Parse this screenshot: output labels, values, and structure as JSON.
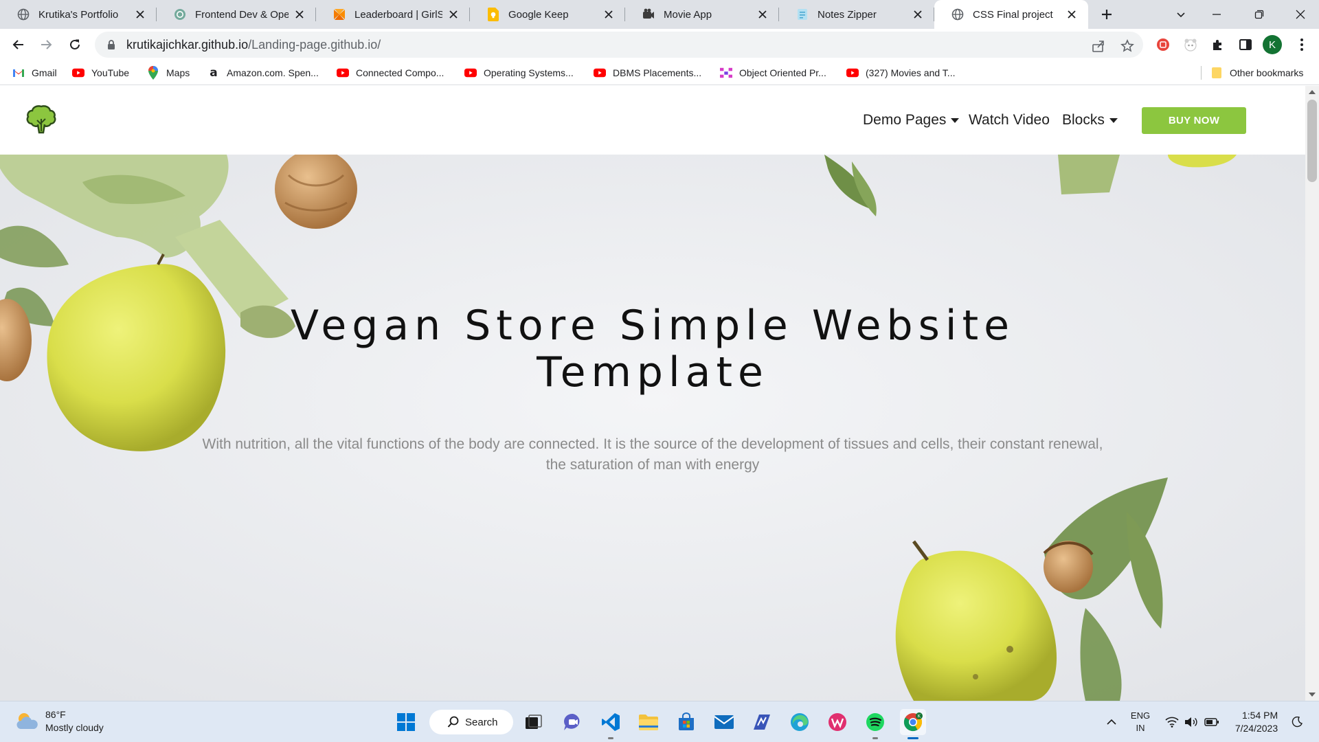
{
  "browser": {
    "tabs": [
      {
        "title": "Krutika's Portfolio",
        "icon": "globe-icon",
        "active": false
      },
      {
        "title": "Frontend Dev & Open",
        "icon": "openai-icon",
        "active": false
      },
      {
        "title": "Leaderboard | GirlScri",
        "icon": "girlscript-icon",
        "active": false
      },
      {
        "title": "Google Keep",
        "icon": "keep-icon",
        "active": false
      },
      {
        "title": "Movie App",
        "icon": "movie-icon",
        "active": false
      },
      {
        "title": "Notes Zipper",
        "icon": "notes-icon",
        "active": false
      },
      {
        "title": "CSS Final project",
        "icon": "globe-icon",
        "active": true
      }
    ],
    "address": {
      "domain": "krutikajichkar.github.io",
      "path": "/Landing-page.github.io/"
    },
    "profile_initial": "K",
    "bookmarks": [
      {
        "label": "Gmail",
        "icon": "gmail-icon"
      },
      {
        "label": "YouTube",
        "icon": "youtube-icon"
      },
      {
        "label": "Maps",
        "icon": "maps-icon"
      },
      {
        "label": "Amazon.com. Spen...",
        "icon": "amazon-icon"
      },
      {
        "label": "Connected Compo...",
        "icon": "youtube-icon"
      },
      {
        "label": "Operating Systems...",
        "icon": "youtube-icon"
      },
      {
        "label": "DBMS Placements...",
        "icon": "youtube-icon"
      },
      {
        "label": "Object Oriented Pr...",
        "icon": "oop-icon"
      },
      {
        "label": "(327) Movies and T...",
        "icon": "youtube-icon"
      }
    ],
    "other_bookmarks": "Other bookmarks"
  },
  "site": {
    "nav": {
      "demo_pages": "Demo Pages",
      "watch_video": "Watch Video",
      "blocks": "Blocks",
      "buy_now": "BUY NOW"
    },
    "hero": {
      "title": "Vegan Store Simple Website Template",
      "text": "With nutrition, all the vital functions of the body are connected. It is the source of the development of tissues and cells, their constant renewal, the saturation of man with energy"
    },
    "colors": {
      "accent": "#8cc63f",
      "hero_bg": "#e7e9ec"
    }
  },
  "taskbar": {
    "weather": {
      "temp": "86°F",
      "condition": "Mostly cloudy"
    },
    "search_label": "Search",
    "lang": {
      "line1": "ENG",
      "line2": "IN"
    },
    "clock": {
      "time": "1:54 PM",
      "date": "7/24/2023"
    }
  }
}
